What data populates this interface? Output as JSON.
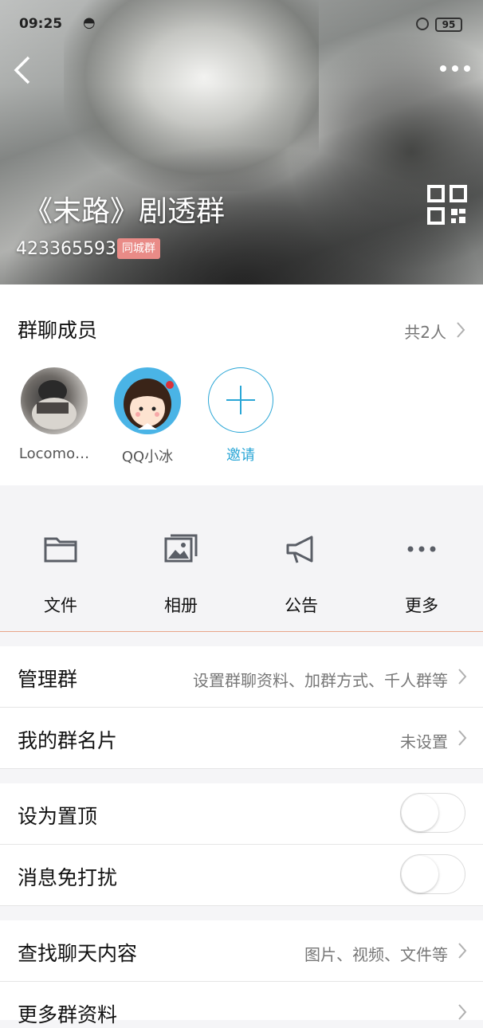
{
  "status_bar": {
    "time": "09:25",
    "battery": "95"
  },
  "header": {
    "title": "《末路》剧透群",
    "group_id": "423365593",
    "badge": "同城群"
  },
  "members": {
    "title": "群聊成员",
    "count": "共2人",
    "list": [
      {
        "name": "Locomo…"
      },
      {
        "name": "QQ小冰"
      }
    ],
    "invite_label": "邀请"
  },
  "actions": [
    {
      "label": "文件",
      "icon": "folder-icon"
    },
    {
      "label": "相册",
      "icon": "album-icon"
    },
    {
      "label": "公告",
      "icon": "megaphone-icon"
    },
    {
      "label": "更多",
      "icon": "more-dots-icon"
    }
  ],
  "settings": {
    "manage": {
      "label": "管理群",
      "value": "设置群聊资料、加群方式、千人群等"
    },
    "card": {
      "label": "我的群名片",
      "value": "未设置"
    },
    "pin": {
      "label": "设为置顶"
    },
    "mute": {
      "label": "消息免打扰"
    },
    "search": {
      "label": "查找聊天内容",
      "value": "图片、视频、文件等"
    },
    "more_info": {
      "label": "更多群资料"
    }
  },
  "colors": {
    "accent": "#2aa6d6",
    "badge": "#e98b87"
  }
}
